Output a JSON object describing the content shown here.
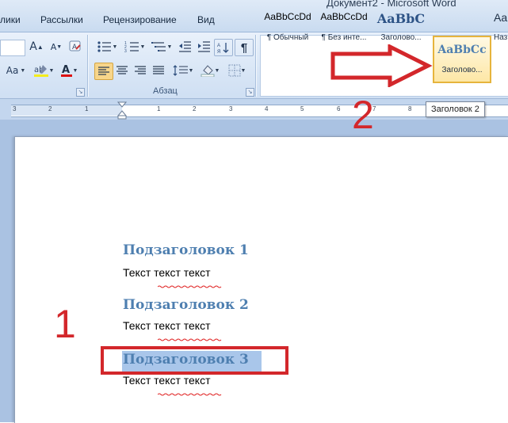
{
  "window_title": "Документ2 - Microsoft Word",
  "menu": [
    "лики",
    "Рассылки",
    "Рецензирование",
    "Вид"
  ],
  "ribbon": {
    "paragraph_group_label": "Абзац",
    "styles": [
      {
        "preview": "AaBbCcDd",
        "name": "¶ Обычный"
      },
      {
        "preview": "AaBbCcDd",
        "name": "¶ Без инте..."
      },
      {
        "preview": "AaBbC",
        "name": "Заголово..."
      },
      {
        "preview": "AaBbCc",
        "name": "Заголово..."
      },
      {
        "preview": "Aa",
        "name": "Наз"
      }
    ]
  },
  "tooltip": "Заголовок 2",
  "ruler_numbers": [
    "3",
    "2",
    "1",
    "1",
    "2",
    "3",
    "4",
    "5",
    "6",
    "7",
    "8"
  ],
  "annotations": {
    "marker_1": "1",
    "marker_2": "2",
    "color": "#d3272b"
  },
  "document": {
    "blocks": [
      {
        "heading": "Подзаголовок 1",
        "text": "Текст текст текст"
      },
      {
        "heading": "Подзаголовок 2",
        "text": "Текст текст текст"
      },
      {
        "heading": "Подзаголовок 3",
        "text": "Текст текст текст"
      }
    ],
    "heading_color": "#4e7fb0",
    "selection_color": "#a9c6ea"
  },
  "icons": [
    "grow-font-icon",
    "shrink-font-icon",
    "clear-format-icon",
    "change-case-icon",
    "highlight-icon",
    "font-color-icon",
    "bullets-icon",
    "numbering-icon",
    "multilevel-list-icon",
    "decrease-indent-icon",
    "increase-indent-icon",
    "sort-icon",
    "show-marks-icon",
    "align-left-icon",
    "center-icon",
    "align-right-icon",
    "justify-icon",
    "line-spacing-icon",
    "shading-icon",
    "borders-icon",
    "red-arrow-icon"
  ]
}
